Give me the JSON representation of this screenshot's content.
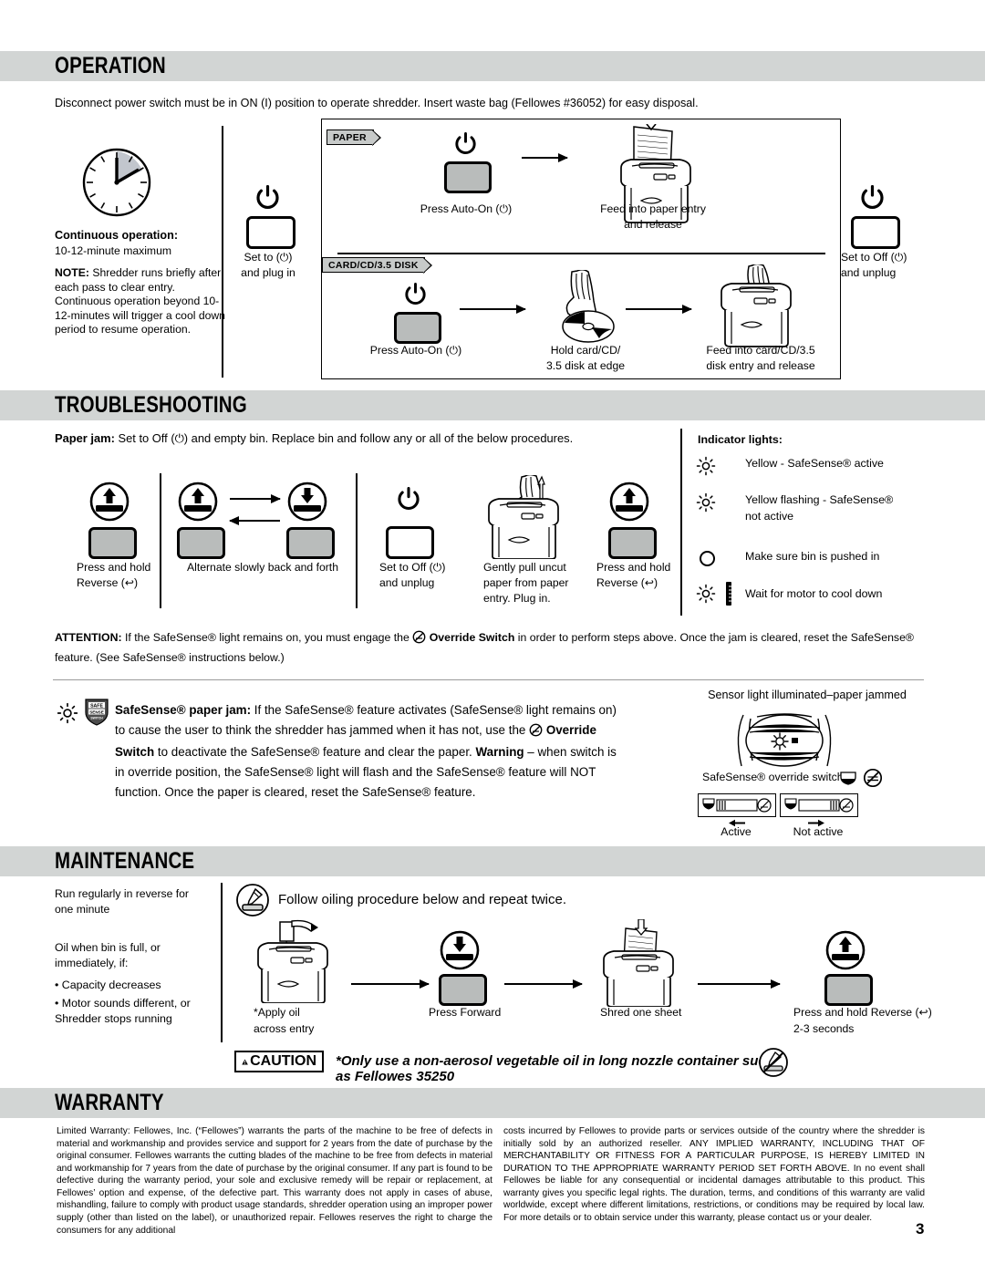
{
  "page": {
    "number": "3"
  },
  "sections": {
    "operation": {
      "title": "OPERATION",
      "intro": "Disconnect power switch must be in ON (I) position to operate shredder. Insert waste bag (Fellowes #36052) for easy disposal.",
      "continuous": {
        "heading": "Continuous operation:",
        "line1": "10-12-minute maximum",
        "note_label": "NOTE:",
        "note_text": "Shredder runs briefly after each pass to clear entry. Continuous operation beyond 10-12-minutes will trigger a cool down period to resume operation."
      },
      "setto": {
        "line1": "Set to (⏻)",
        "line2": "and plug in"
      },
      "paper": {
        "tag": "PAPER",
        "step1": "Press Auto-On (⏻)",
        "step2_line1": "Feed into paper entry",
        "step2_line2": "and release"
      },
      "card": {
        "tag": "CARD/CD/3.5 DISK",
        "step1": "Press Auto-On (⏻)",
        "step2_line1": "Hold card/CD/",
        "step2_line2": "3.5 disk at edge",
        "step3_line1": "Feed into card/CD/3.5",
        "step3_line2": "disk entry and release"
      },
      "setoff": {
        "line1": "Set to Off (⏻)",
        "line2": "and unplug"
      }
    },
    "troubleshooting": {
      "title": "TROUBLESHOOTING",
      "paperjam_label": "Paper jam:",
      "paperjam_text": "Set to Off (⏻) and empty bin. Replace bin and follow any or all of the below procedures.",
      "steps": [
        {
          "line1": "Press and hold",
          "line2": "Reverse (↩)"
        },
        {
          "line1": "Alternate slowly back and forth",
          "line2": ""
        },
        {
          "line1": "Set to Off (⏻)",
          "line2": "and unplug"
        },
        {
          "line1": "Gently pull uncut",
          "line2": "paper from paper",
          "line3": "entry. Plug in."
        },
        {
          "line1": "Press and hold",
          "line2": "Reverse (↩)"
        }
      ],
      "indicator": {
        "title": "Indicator lights:",
        "rows": [
          {
            "icon": "sun-icon",
            "line1": "Yellow - SafeSense® active",
            "line2": ""
          },
          {
            "icon": "sun-icon",
            "line1": "Yellow flashing - SafeSense®",
            "line2": "not active"
          },
          {
            "icon": "circle-icon",
            "line1": "Make sure bin is pushed in",
            "line2": ""
          },
          {
            "icon": "sun-thermometer-icon",
            "line1": "Wait for motor to cool down",
            "line2": ""
          }
        ]
      },
      "attention": {
        "label": "ATTENTION:",
        "part1": "If the SafeSense® light remains on, you must engage the",
        "override": "Override Switch",
        "part2": "in order to perform steps above. Once the jam is cleared, reset the SafeSense® feature.",
        "part3": "(See SafeSense® instructions below.)"
      },
      "safesense": {
        "label": "SafeSense® paper jam:",
        "part1": "If the SafeSense® feature activates (SafeSense® light remains on) to cause the user to think the shredder has jammed when it has not, use the",
        "override": "Override Switch",
        "part2": "to deactivate the SafeSense® feature and clear the paper.",
        "warning": "Warning",
        "part3": "– when switch is in override position, the SafeSense® light will flash and the SafeSense® feature will NOT function. Once the paper is cleared, reset the SafeSense® feature.",
        "shield_line1": "SAFE",
        "shield_line2": "SENSE",
        "shield_line3": "SWITCH"
      },
      "sensor": {
        "caption": "Sensor light illuminated–paper jammed",
        "override_label": "SafeSense® override switch",
        "active": "Active",
        "notactive": "Not active"
      }
    },
    "maintenance": {
      "title": "MAINTENANCE",
      "left_line1": "Run regularly in reverse for",
      "left_line2": "one minute",
      "left_line3": "Oil when bin is full, or",
      "left_line4": "immediately, if:",
      "bullets": [
        "Capacity decreases",
        "Motor sounds different, or Shredder stops running"
      ],
      "oiling_header": "Follow oiling procedure below and repeat twice.",
      "steps": [
        {
          "line1": "*Apply oil",
          "line2": "across entry"
        },
        {
          "line1": "Press Forward",
          "line2": ""
        },
        {
          "line1": "Shred one sheet",
          "line2": ""
        },
        {
          "line1": "Press and hold Reverse (↩)",
          "line2": "2-3 seconds"
        }
      ],
      "caution_label": "CAUTION",
      "caution_text": "*Only use a non-aerosol vegetable oil in long nozzle container such as Fellowes 35250"
    },
    "warranty": {
      "title": "WARRANTY",
      "col_left": "Limited Warranty:  Fellowes, Inc. (“Fellowes”) warrants the parts of the machine to be free of defects in material and workmanship and provides service and support for 2 years from the date of purchase by the original consumer.  Fellowes warrants the cutting blades of the machine to be free from defects in material and workmanship for 7 years from the date of purchase by the original consumer. If any part is found to be defective during the warranty period, your sole and exclusive remedy will be repair or replacement, at Fellowes’ option and expense, of the defective part. This warranty does not apply in cases of abuse, mishandling, failure to comply with product usage standards, shredder operation using an improper power supply (other than listed on the label), or unauthorized repair. Fellowes reserves the right to charge the consumers for any additional",
      "col_right": "costs incurred by Fellowes to provide parts or services outside of the country where the shredder is initially sold by an authorized reseller. ANY IMPLIED WARRANTY, INCLUDING THAT OF MERCHANTABILITY OR FITNESS FOR A PARTICULAR PURPOSE, IS HEREBY LIMITED IN DURATION TO THE APPROPRIATE WARRANTY PERIOD SET FORTH ABOVE. In no event shall Fellowes be liable for any consequential or incidental damages attributable to this product. This warranty gives you specific legal rights. The duration, terms, and conditions of this warranty are valid worldwide, except where different limitations, restrictions, or conditions may be required by local law. For more details or to obtain service under this warranty, please contact us or your dealer."
    }
  },
  "colors": {
    "section_bar": "#d2d5d4",
    "button_fill": "#b9bcbb",
    "tag_fill": "#c7cac9",
    "line": "#000000"
  }
}
